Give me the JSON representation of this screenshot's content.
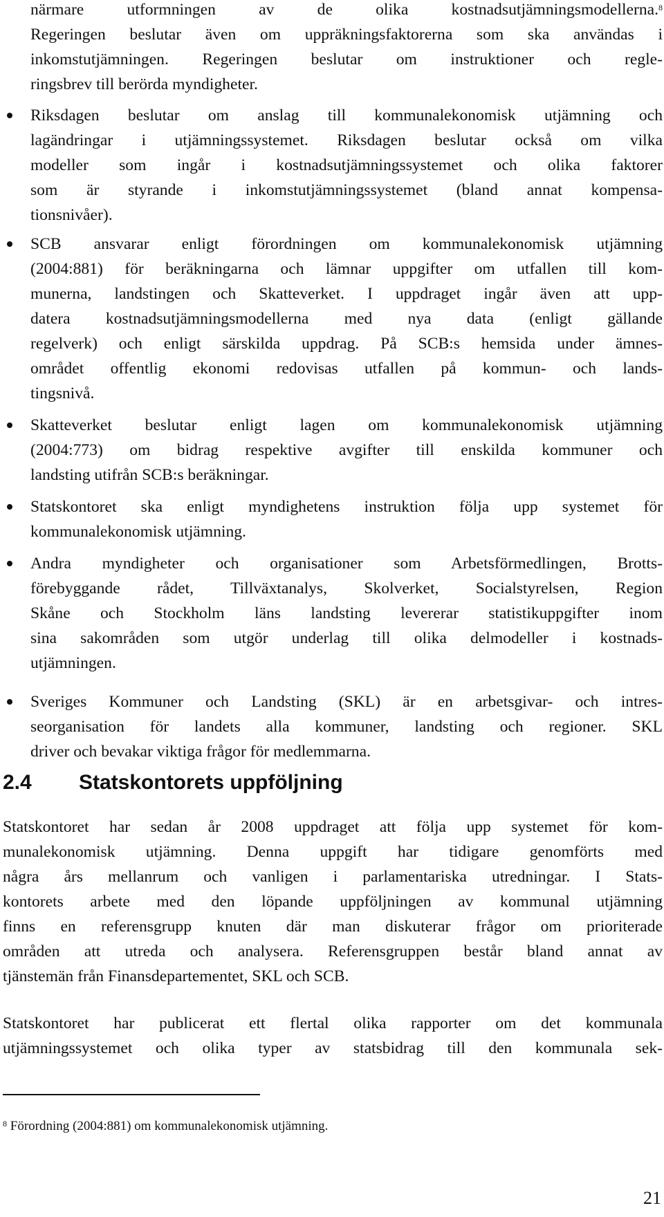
{
  "intro_paragraph": {
    "lines": [
      "närmare utformningen av de olika kostnadsutjämningsmodellerna.",
      "Regeringen beslutar även om uppräkningsfaktorerna som ska användas i",
      "inkomstutjämningen. Regeringen beslutar om instruktioner och regle-",
      "ringsbrev till berörda myndigheter."
    ],
    "footnote_ref": "8"
  },
  "bullets": [
    {
      "lines": [
        "Riksdagen beslutar om anslag till kommunalekonomisk utjämning och",
        "lagändringar i utjämningssystemet. Riksdagen beslutar också om vilka",
        "modeller som ingår i kostnadsutjämningssystemet och olika faktorer",
        "som är styrande i inkomstutjämningssystemet (bland annat kompensa-",
        "tionsnivåer)."
      ]
    },
    {
      "lines": [
        "SCB ansvarar enligt förordningen om kommunalekonomisk utjämning",
        "(2004:881) för beräkningarna och lämnar uppgifter om utfallen till kom-",
        "munerna, landstingen och Skatteverket. I uppdraget ingår även att upp-",
        "datera kostnadsutjämningsmodellerna med nya data (enligt gällande",
        "regelverk) och enligt särskilda uppdrag. På SCB:s hemsida under ämnes-",
        "området offentlig ekonomi redovisas utfallen på kommun- och lands-",
        "tingsnivå."
      ]
    },
    {
      "lines": [
        "Skatteverket beslutar enligt lagen om kommunalekonomisk utjämning",
        "(2004:773) om bidrag respektive avgifter till enskilda kommuner och",
        "landsting utifrån SCB:s beräkningar."
      ]
    },
    {
      "lines": [
        "Statskontoret ska enligt myndighetens instruktion följa upp systemet för",
        "kommunalekonomisk utjämning."
      ]
    },
    {
      "lines": [
        "Andra myndigheter och organisationer som Arbetsförmedlingen, Brotts-",
        "förebyggande rådet, Tillväxtanalys, Skolverket, Socialstyrelsen, Region",
        "Skåne och Stockholm läns landsting levererar statistikuppgifter inom",
        "sina sakområden som utgör underlag till olika delmodeller i kostnads-",
        "utjämningen."
      ]
    },
    {
      "lines": [
        "Sveriges Kommuner och Landsting (SKL) är en arbetsgivar- och intres-",
        "seorganisation för landets alla kommuner, landsting och regioner. SKL",
        "driver och bevakar viktiga frågor för medlemmarna."
      ]
    }
  ],
  "section": {
    "number": "2.4",
    "title": "Statskontorets uppföljning"
  },
  "paragraphs": [
    {
      "lines": [
        "Statskontoret har sedan år 2008 uppdraget att följa upp systemet för kom-",
        "munalekonomisk utjämning. Denna uppgift har tidigare genomförts med",
        "några års mellanrum och vanligen i parlamentariska utredningar. I Stats-",
        "kontorets arbete med den löpande uppföljningen av kommunal utjämning",
        "finns en referensgrupp knuten där man diskuterar frågor om prioriterade",
        "områden att utreda och analysera. Referensgruppen består bland annat av",
        "tjänstemän från Finansdepartementet, SKL och SCB."
      ]
    },
    {
      "lines": [
        "Statskontoret har publicerat ett flertal olika rapporter om det kommunala",
        "utjämningssystemet och olika typer av statsbidrag till den kommunala sek-"
      ]
    }
  ],
  "footnote": {
    "number": "8",
    "text": "Förordning (2004:881) om kommunalekonomisk utjämning."
  },
  "page_number": "21"
}
